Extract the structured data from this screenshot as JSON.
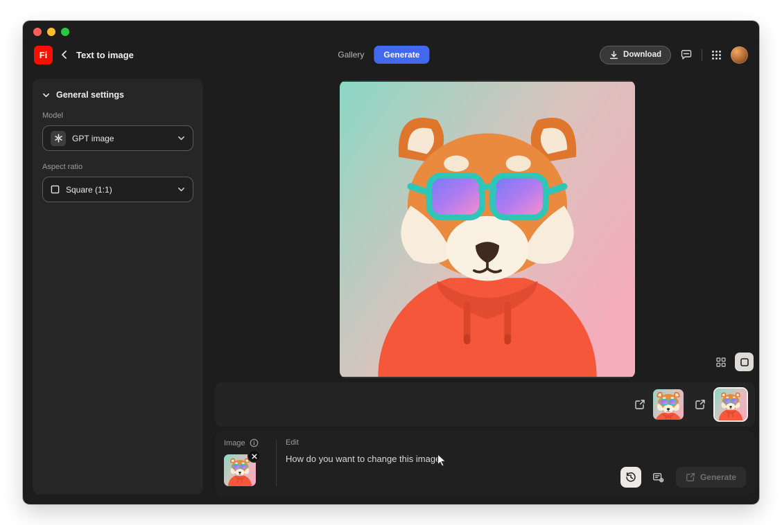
{
  "header": {
    "logo_text": "Fi",
    "title": "Text to image",
    "gallery_label": "Gallery",
    "generate_label": "Generate",
    "download_label": "Download"
  },
  "sidebar": {
    "section_title": "General settings",
    "model": {
      "label": "Model",
      "value": "GPT image"
    },
    "aspect_ratio": {
      "label": "Aspect ratio",
      "value": "Square (1:1)"
    }
  },
  "composer": {
    "image_label": "Image",
    "edit_label": "Edit",
    "prompt_placeholder": "How do you want to change this image",
    "generate_label": "Generate"
  },
  "icons": [
    "back-chevron-icon",
    "download-icon",
    "feedback-icon",
    "apps-grid-icon",
    "chevron-down-icon",
    "openai-logo-icon",
    "square-aspect-icon",
    "grid-view-icon",
    "single-view-icon",
    "export-icon",
    "info-icon",
    "close-icon",
    "history-icon",
    "prompt-settings-icon",
    "mouse-cursor-icon"
  ],
  "colors": {
    "accent_blue": "#4368F0",
    "adobe_red": "#FA0F00",
    "traffic_red": "#FF5F57",
    "traffic_yellow": "#FEBC2E",
    "traffic_green": "#28C840",
    "image_bg_gradient_start": "#8BD8C4",
    "image_bg_gradient_end": "#F5ACBB",
    "sunglasses_teal": "#2FC6B7",
    "hoodie_orange": "#F4573A"
  }
}
